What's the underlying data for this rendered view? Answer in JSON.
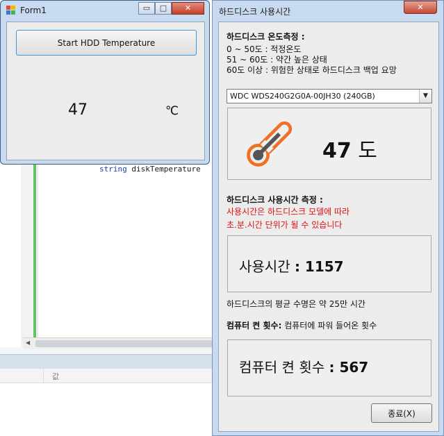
{
  "ide": {
    "code_keyword": "string",
    "code_text": " diskTemperature",
    "grid_column": "값"
  },
  "form1": {
    "title": "Form1",
    "start_button": "Start HDD Temperature",
    "temperature": "47",
    "unit": "℃",
    "minimize": "▭",
    "maximize": "□",
    "close": "✕"
  },
  "hdd": {
    "title": "하드디스크 사용시간",
    "close": "✕",
    "temp_section": {
      "title": "하드디스크 온도측정 :",
      "lines": [
        "0  ~ 50도 : 적정온도",
        "51 ~ 60도 : 약간 높은 상태",
        "60도 이상 : 위험한 상태로 하드디스크 백업 요망"
      ]
    },
    "disk_select": "WDC WDS240G2G0A-00JH30 (240GB)",
    "temperature": {
      "value": "47",
      "unit": "도"
    },
    "usage_section": {
      "title": "하드디스크 사용시간 측정 :",
      "notes": [
        "사용시간은 하드디스크 모델에 따라",
        "초.분.시간 단위가 될 수 있습니다"
      ]
    },
    "usage": {
      "label": "사용시간",
      "value": ": 1157"
    },
    "lifespan": "하드디스크의 평균 수명은 약 25만 시간",
    "power_section": {
      "title": "컴퓨터 켠 횟수:",
      "description": " 컴퓨터에 파워 들어온 횟수"
    },
    "power": {
      "label": "컴퓨터 켠 횟수",
      "value": ": 567"
    },
    "exit_button": "종료(X)"
  },
  "colors": {
    "accent_blue": "#3c96d8",
    "warning_red": "#e01010",
    "thermometer": "#f07028",
    "window_frame": "#c8daf0"
  },
  "icons": {
    "thermometer": "thermometer-icon",
    "dropdown": "chevron-down-icon"
  }
}
